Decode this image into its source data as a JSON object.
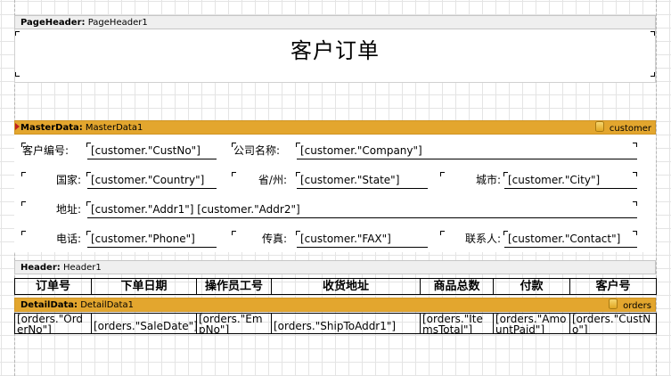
{
  "page_header": {
    "band_type": "PageHeader:",
    "band_name": "PageHeader1",
    "title": "客户订单"
  },
  "master_data": {
    "band_type": "MasterData:",
    "band_name": "MasterData1",
    "datasource": "customer",
    "rows": [
      {
        "label1": "客户编号:",
        "field1": "[customer.\"CustNo\"]",
        "label2": "公司名称:",
        "field2": "[customer.\"Company\"]"
      },
      {
        "label1": "国家:",
        "field1": "[customer.\"Country\"]",
        "label2": "省/州:",
        "field2": "[customer.\"State\"]",
        "label3": "城市:",
        "field3": "[customer.\"City\"]"
      },
      {
        "label1": "地址:",
        "field1": "[customer.\"Addr1\"] [customer.\"Addr2\"]"
      },
      {
        "label1": "电话:",
        "field1": "[customer.\"Phone\"]",
        "label2": "传真:",
        "field2": "[customer.\"FAX\"]",
        "label3": "联系人:",
        "field3": "[customer.\"Contact\"]"
      }
    ]
  },
  "header": {
    "band_type": "Header:",
    "band_name": "Header1",
    "columns": [
      "订单号",
      "下单日期",
      "操作员工号",
      "收货地址",
      "商品总数",
      "付款",
      "客户号"
    ]
  },
  "detail_data": {
    "band_type": "DetailData:",
    "band_name": "DetailData1",
    "datasource": "orders",
    "cells": [
      "[orders.\"OrderNo\"]",
      "[orders.\"SaleDate\"]",
      "[orders.\"EmpNo\"]",
      "[orders.\"ShipToAddr1\"]",
      "[orders.\"ItemsTotal\"]",
      "[orders.\"AmountPaid\"]",
      "[orders.\"CustNo\"]"
    ]
  },
  "colors": {
    "data_band": "#e3a62e",
    "header_band": "#efefef",
    "grid": "#e4e4e4"
  }
}
